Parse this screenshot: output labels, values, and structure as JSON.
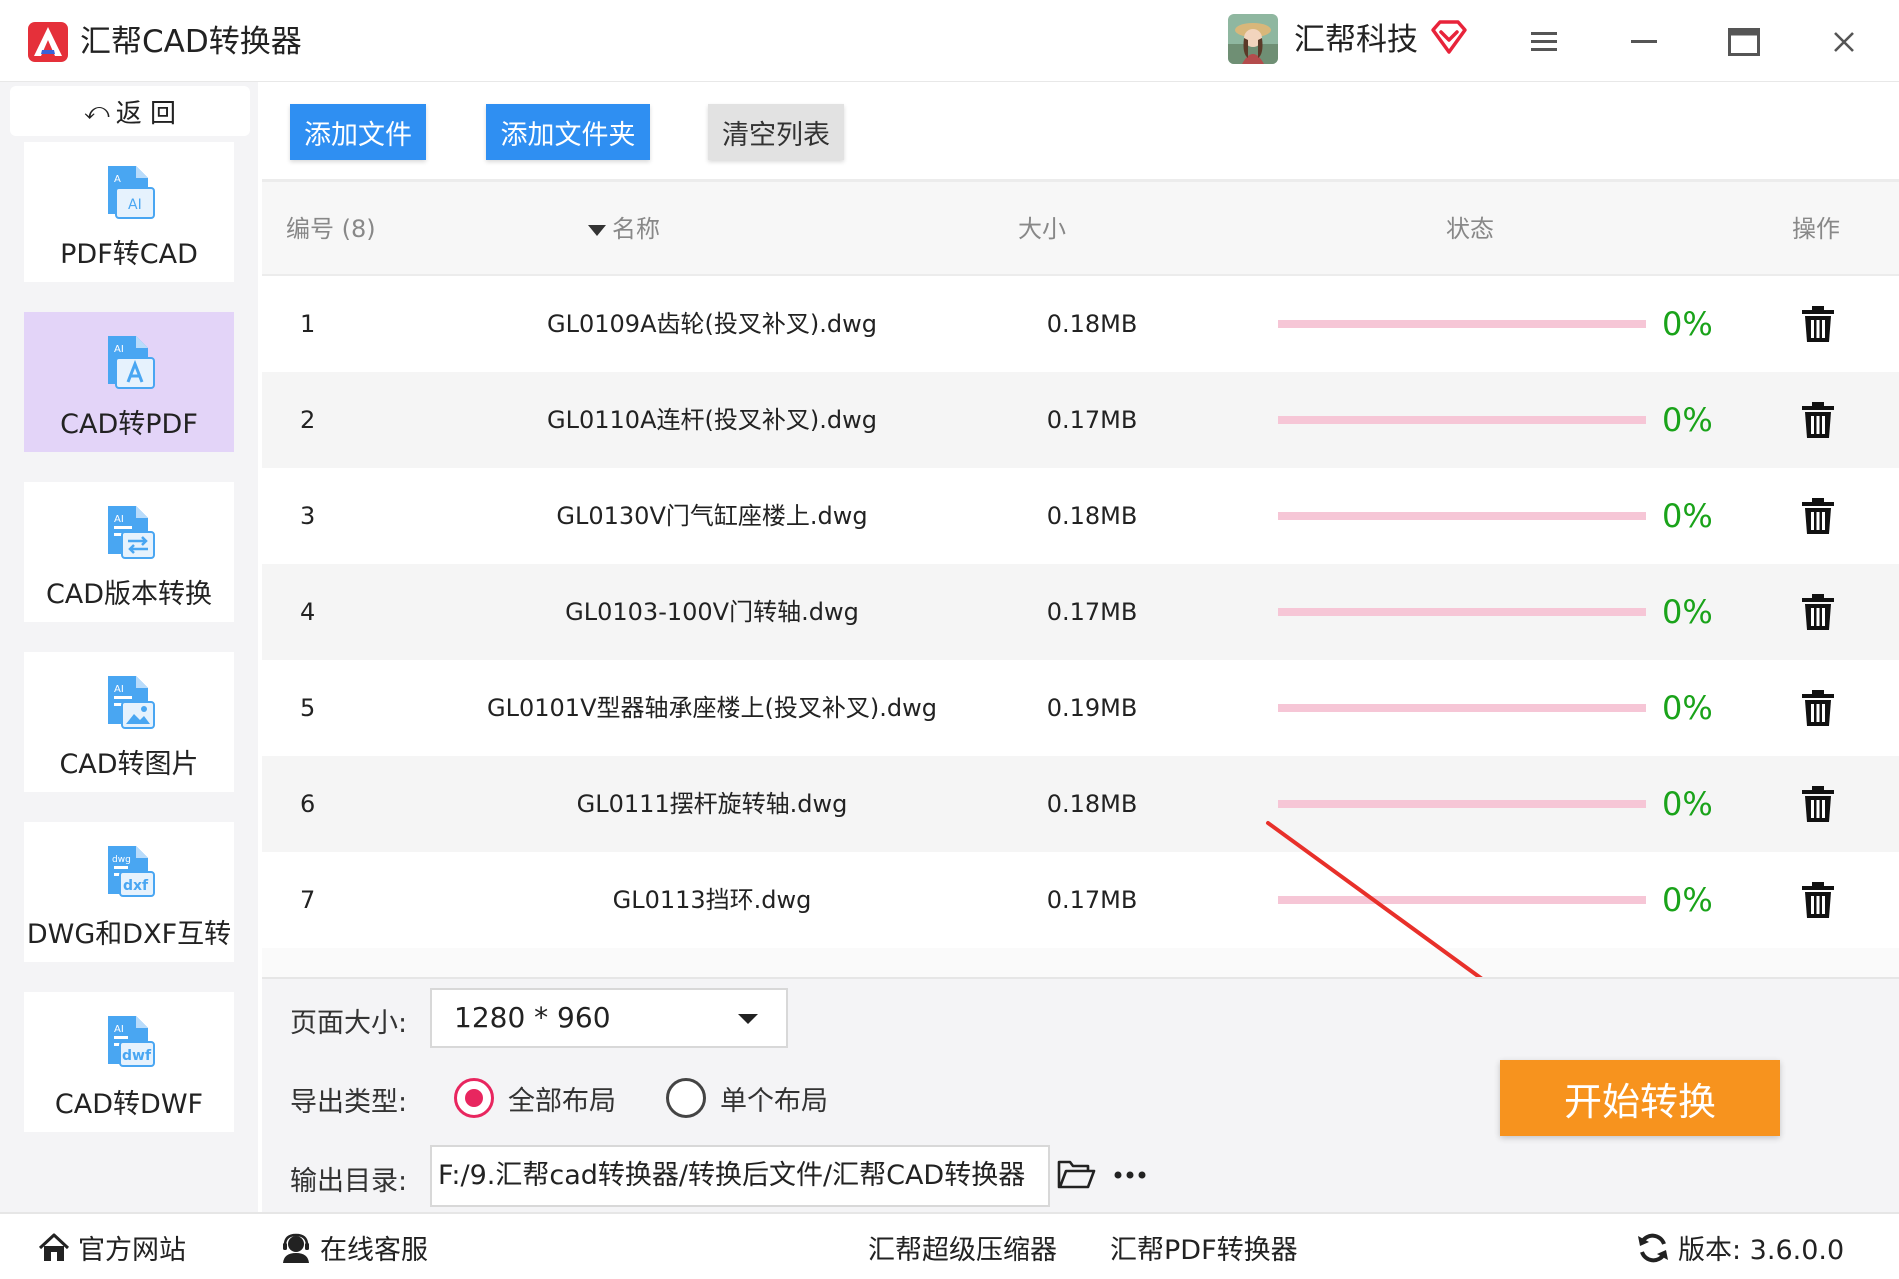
{
  "titlebar": {
    "app_title": "汇帮CAD转换器",
    "user_name": "汇帮科技",
    "icons": [
      "app-logo",
      "avatar",
      "vip-diamond-icon",
      "menu-icon",
      "minimize-icon",
      "maximize-icon",
      "close-icon"
    ]
  },
  "sidebar": {
    "back_label": "返 回",
    "items": [
      {
        "label": "PDF转CAD",
        "icon": "pdf-to-cad-icon",
        "active": false
      },
      {
        "label": "CAD转PDF",
        "icon": "cad-to-pdf-icon",
        "active": true
      },
      {
        "label": "CAD版本转换",
        "icon": "cad-version-icon",
        "active": false
      },
      {
        "label": "CAD转图片",
        "icon": "cad-to-image-icon",
        "active": false
      },
      {
        "label": "DWG和DXF互转",
        "icon": "dwg-dxf-icon",
        "active": false
      },
      {
        "label": "CAD转DWF",
        "icon": "cad-to-dwf-icon",
        "active": false
      }
    ]
  },
  "toolbar": {
    "add_file": "添加文件",
    "add_folder": "添加文件夹",
    "clear_list": "清空列表"
  },
  "table": {
    "headers": {
      "index": "编号 (8)",
      "name": "名称",
      "size": "大小",
      "status": "状态",
      "action": "操作"
    },
    "rows": [
      {
        "index": "1",
        "name": "GL0109A齿轮(投叉补叉).dwg",
        "size": "0.18MB",
        "percent": "0%",
        "progress": 0
      },
      {
        "index": "2",
        "name": "GL0110A连杆(投叉补叉).dwg",
        "size": "0.17MB",
        "percent": "0%",
        "progress": 0
      },
      {
        "index": "3",
        "name": "GL0130V门气缸座楼上.dwg",
        "size": "0.18MB",
        "percent": "0%",
        "progress": 0
      },
      {
        "index": "4",
        "name": "GL0103-100V门转轴.dwg",
        "size": "0.17MB",
        "percent": "0%",
        "progress": 0
      },
      {
        "index": "5",
        "name": "GL0101V型器轴承座楼上(投叉补叉).dwg",
        "size": "0.19MB",
        "percent": "0%",
        "progress": 0
      },
      {
        "index": "6",
        "name": "GL0111摆杆旋转轴.dwg",
        "size": "0.18MB",
        "percent": "0%",
        "progress": 0
      },
      {
        "index": "7",
        "name": "GL0113挡环.dwg",
        "size": "0.17MB",
        "percent": "0%",
        "progress": 0
      }
    ]
  },
  "settings": {
    "page_size_label": "页面大小:",
    "page_size_value": "1280 * 960",
    "export_type_label": "导出类型:",
    "export_options": [
      {
        "label": "全部布局",
        "checked": true
      },
      {
        "label": "单个布局",
        "checked": false
      }
    ],
    "output_label": "输出目录:",
    "output_path": "F:/9.汇帮cad转换器/转换后文件/汇帮CAD转换器",
    "start_button": "开始转换"
  },
  "footer": {
    "official_site": "官方网站",
    "online_service": "在线客服",
    "compressor": "汇帮超级压缩器",
    "pdf_converter": "汇帮PDF转换器",
    "version": "版本: 3.6.0.0"
  },
  "colors": {
    "primary_blue": "#2f8ff2",
    "active_nav": "#e3d4f8",
    "start_orange": "#f7931e",
    "progress_track": "#f6c6d6",
    "percent_green": "#1aa31a",
    "radio_checked": "#e8265f",
    "annotation_red": "#e8302a"
  }
}
